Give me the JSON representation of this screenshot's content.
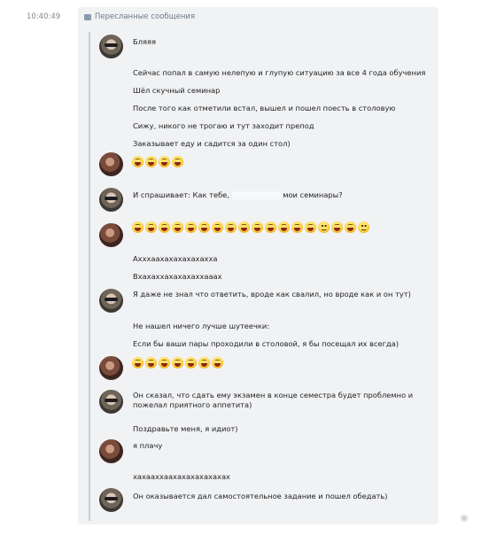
{
  "time": "10:40:49",
  "header": {
    "title": "Пересланные сообщения"
  },
  "messages": {
    "m1": "Бляяя",
    "m2": "Сейчас попал в самую нелепую и глупую ситуацию за все 4 года обучения",
    "m3": "Шёл скучный семинар",
    "m4": "После того как отметили встал, вышел и пошел поесть в столовую",
    "m5": "Сижу, никого не трогаю и тут заходит препод",
    "m6": "Заказывает еду и садится за один стол)",
    "m7a": "И спрашивает: Как тебе,",
    "m7b": "мои семинары?",
    "m8": "Ахххаахахахахахахха",
    "m9": "Вхахаххахахахаххааах",
    "m10": "Я даже не знал что ответить, вроде как свалил, но вроде как и он тут)",
    "m11": "Не нашел ничего лучше шутеечки:",
    "m12": "Если бы ваши пары проходили в столовой, я бы посещал их всегда)",
    "m13": "Он сказал, что сдать ему экзамен в конце семестра будет проблемно и пожелал приятного аппетита)",
    "m14": "Поздравьте меня, я идиот)",
    "m15": "я плачу",
    "m16": "хахааххаахахахахахахах",
    "m17": "Он оказывается дал самостоятельное задание и пошел обедать)"
  },
  "emoji": {
    "row1": [
      "laugh",
      "laugh",
      "laugh",
      "laugh"
    ],
    "row2": [
      "laugh",
      "laugh",
      "laugh",
      "laugh",
      "laugh",
      "laugh",
      "laugh",
      "laugh",
      "laugh",
      "laugh",
      "laugh",
      "laugh",
      "laugh",
      "laugh",
      "neutral",
      "laugh",
      "laugh",
      "neutral"
    ],
    "row3": [
      "laugh",
      "laugh",
      "laugh",
      "laugh",
      "laugh",
      "laugh",
      "laugh"
    ]
  },
  "colors": {
    "panel": "#f1f2f4",
    "accent": "#6b7a8b",
    "rule": "#c8cfd9"
  }
}
